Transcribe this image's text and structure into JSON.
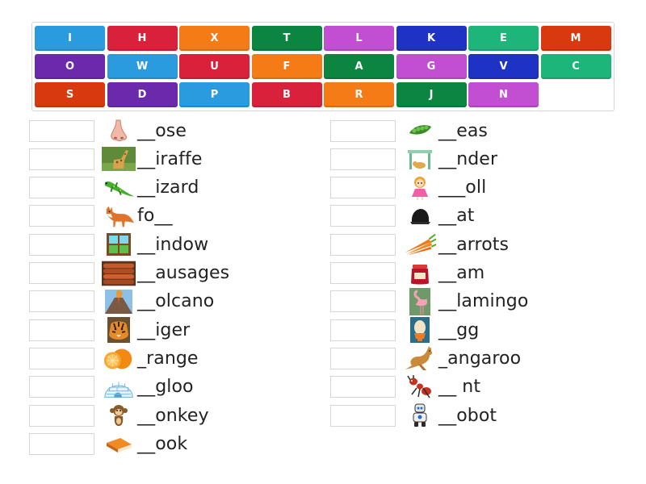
{
  "tiles": [
    {
      "letter": "I",
      "color": "#2b9be0"
    },
    {
      "letter": "H",
      "color": "#d9213b"
    },
    {
      "letter": "X",
      "color": "#f47b16"
    },
    {
      "letter": "T",
      "color": "#0c8540"
    },
    {
      "letter": "L",
      "color": "#c24fd1"
    },
    {
      "letter": "K",
      "color": "#1e33c4"
    },
    {
      "letter": "E",
      "color": "#1eb57a"
    },
    {
      "letter": "M",
      "color": "#d9390f"
    },
    {
      "letter": "O",
      "color": "#6a2aab"
    },
    {
      "letter": "W",
      "color": "#2b9be0"
    },
    {
      "letter": "U",
      "color": "#d9213b"
    },
    {
      "letter": "F",
      "color": "#f47b16"
    },
    {
      "letter": "A",
      "color": "#0c8540"
    },
    {
      "letter": "G",
      "color": "#c24fd1"
    },
    {
      "letter": "V",
      "color": "#1e33c4"
    },
    {
      "letter": "C",
      "color": "#1eb57a"
    },
    {
      "letter": "S",
      "color": "#d9390f"
    },
    {
      "letter": "D",
      "color": "#6a2aab"
    },
    {
      "letter": "P",
      "color": "#2b9be0"
    },
    {
      "letter": "B",
      "color": "#d9213b"
    },
    {
      "letter": "R",
      "color": "#f47b16"
    },
    {
      "letter": "J",
      "color": "#0c8540"
    },
    {
      "letter": "N",
      "color": "#c24fd1"
    }
  ],
  "left_items": [
    {
      "text": "__ose",
      "icon": "nose-icon"
    },
    {
      "text": "__iraffe",
      "icon": "giraffe-icon"
    },
    {
      "text": "__izard",
      "icon": "lizard-icon"
    },
    {
      "text": "fo__",
      "icon": "fox-icon"
    },
    {
      "text": "__indow",
      "icon": "window-icon"
    },
    {
      "text": "__ausages",
      "icon": "sausages-icon"
    },
    {
      "text": "__olcano",
      "icon": "volcano-icon"
    },
    {
      "text": "__iger",
      "icon": "tiger-icon"
    },
    {
      "text": "_range",
      "icon": "orange-icon"
    },
    {
      "text": "__gloo",
      "icon": "igloo-icon"
    },
    {
      "text": "__onkey",
      "icon": "monkey-icon"
    },
    {
      "text": "__ook",
      "icon": "book-icon"
    }
  ],
  "right_items": [
    {
      "text": "__eas",
      "icon": "peas-icon"
    },
    {
      "text": "__nder",
      "icon": "under-table-icon"
    },
    {
      "text": "___oll",
      "icon": "doll-icon"
    },
    {
      "text": "__at",
      "icon": "hat-icon"
    },
    {
      "text": "__arrots",
      "icon": "carrots-icon"
    },
    {
      "text": "__am",
      "icon": "jam-icon"
    },
    {
      "text": "__lamingo",
      "icon": "flamingo-icon"
    },
    {
      "text": "__gg",
      "icon": "egg-icon"
    },
    {
      "text": "_angaroo",
      "icon": "kangaroo-icon"
    },
    {
      "text": "__ nt",
      "icon": "ant-icon"
    },
    {
      "text": "__obot",
      "icon": "robot-icon"
    }
  ]
}
